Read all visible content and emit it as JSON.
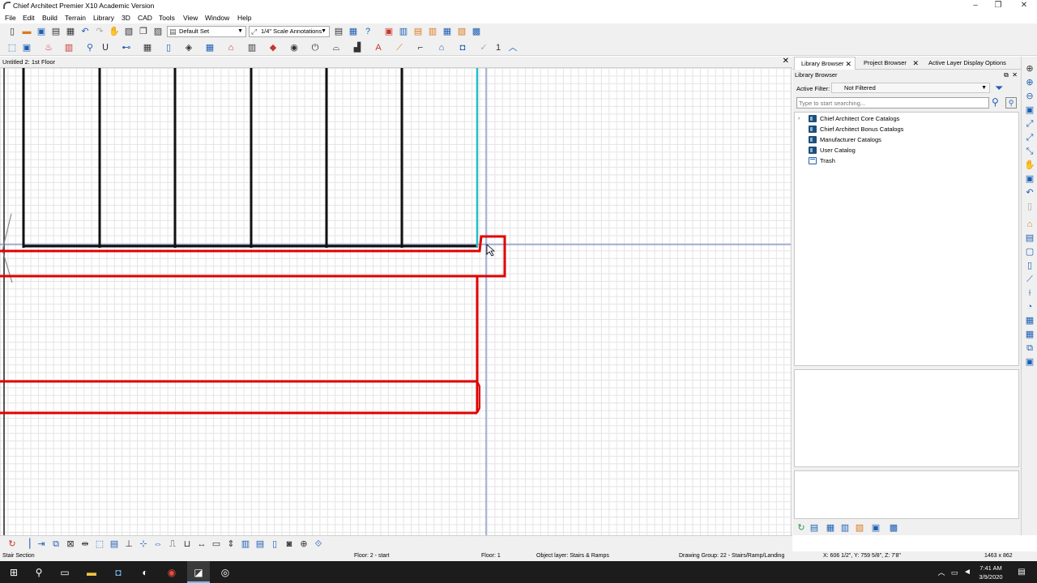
{
  "window": {
    "title": "Chief Architect Premier X10 Academic Version"
  },
  "menu": [
    "File",
    "Edit",
    "Build",
    "Terrain",
    "Library",
    "3D",
    "CAD",
    "Tools",
    "View",
    "Window",
    "Help"
  ],
  "toolbar": {
    "layer_set": "Default Set",
    "annotation_set": "1/4\" Scale Annotations",
    "repeat_count": "1"
  },
  "document_tab": {
    "label": "Untitled 2: 1st Floor"
  },
  "right_panel": {
    "tabs": [
      "Library Browser",
      "Project Browser",
      "Active Layer Display Options"
    ],
    "header": "Library Browser",
    "active_filter_label": "Active Filter:",
    "active_filter_value": "Not Filtered",
    "search_placeholder": "Type to start searching...",
    "tree": [
      {
        "label": "Chief Architect Core Catalogs",
        "expandable": true,
        "icon": "catalog-icon"
      },
      {
        "label": "Chief Architect Bonus Catalogs",
        "expandable": false,
        "icon": "catalog-icon"
      },
      {
        "label": "Manufacturer Catalogs",
        "expandable": false,
        "icon": "catalog-icon"
      },
      {
        "label": "User Catalog",
        "expandable": false,
        "icon": "folder-icon"
      },
      {
        "label": "Trash",
        "expandable": false,
        "icon": "trash-icon"
      }
    ]
  },
  "status": {
    "mode": "Stair Section",
    "floor_info": "Floor: 2 - start",
    "floor": "Floor: 1",
    "object_layer": "Object layer: Stairs & Ramps",
    "drawing_group": "Drawing Group: 22 - Stairs/Ramp/Landing",
    "coords": "X: 606 1/2\", Y: 759 5/8\", Z: 7'8\"",
    "size": "1463 x 862"
  },
  "taskbar": {
    "time": "7:41 AM",
    "date": "3/9/2020"
  },
  "colors": {
    "selection_red": "#e00000",
    "wall_black": "#111111",
    "accent_cyan": "#20c0c8",
    "crosshair_blue": "#5a6eb8"
  }
}
